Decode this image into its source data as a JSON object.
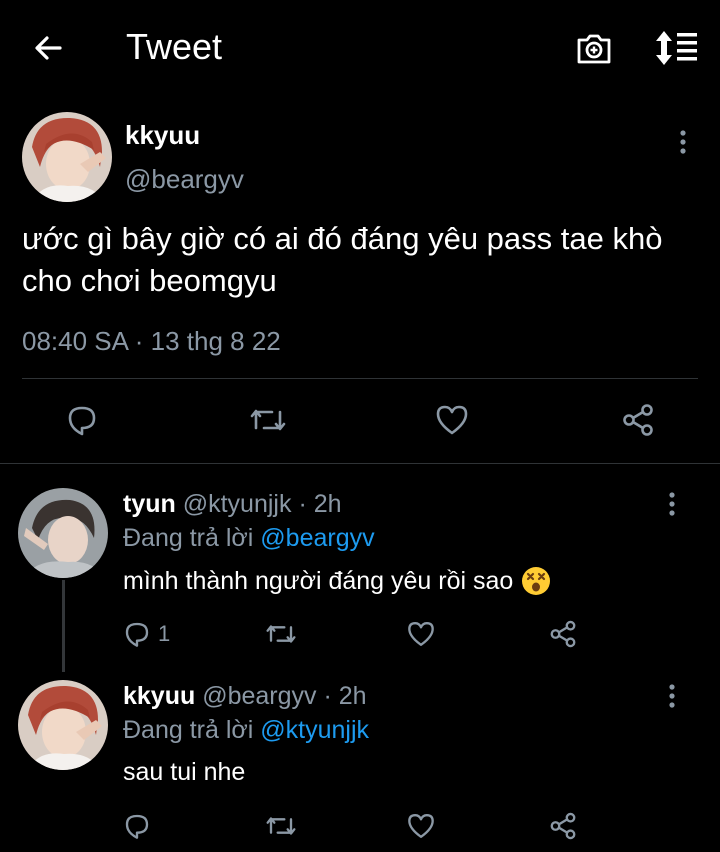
{
  "header": {
    "title": "Tweet",
    "back_icon": "arrow-left-icon",
    "camera_icon": "camera-plus-icon",
    "sort_icon": "sort-icon"
  },
  "main_tweet": {
    "name": "kkyuu",
    "handle": "@beargyv",
    "text": "ước gì bây giờ có ai đó đáng yêu pass tae khò cho chơi beomgyu",
    "timestamp": "08:40 SA · 13 thg 8 22",
    "actions": [
      "reply-icon",
      "retweet-icon",
      "like-icon",
      "share-icon"
    ]
  },
  "replies": [
    {
      "name": "tyun",
      "handle": "@ktyunjjk",
      "time": "· 2h",
      "replying_prefix": "Đang trả lời",
      "replying_to": "@beargyv",
      "text": "mình thành người đáng yêu rồi sao",
      "emoji": "dizzy-face-emoji",
      "reply_count": "1"
    },
    {
      "name": "kkyuu",
      "handle": "@beargyv",
      "time": "· 2h",
      "replying_prefix": "Đang trả lời",
      "replying_to": "@ktyunjjk",
      "text": "sau tui nhe",
      "reply_count": ""
    }
  ],
  "colors": {
    "background": "#000000",
    "text": "#e7e9ea",
    "secondary": "#8b98a5",
    "accent": "#1d9bf0",
    "divider": "#2f3336"
  }
}
